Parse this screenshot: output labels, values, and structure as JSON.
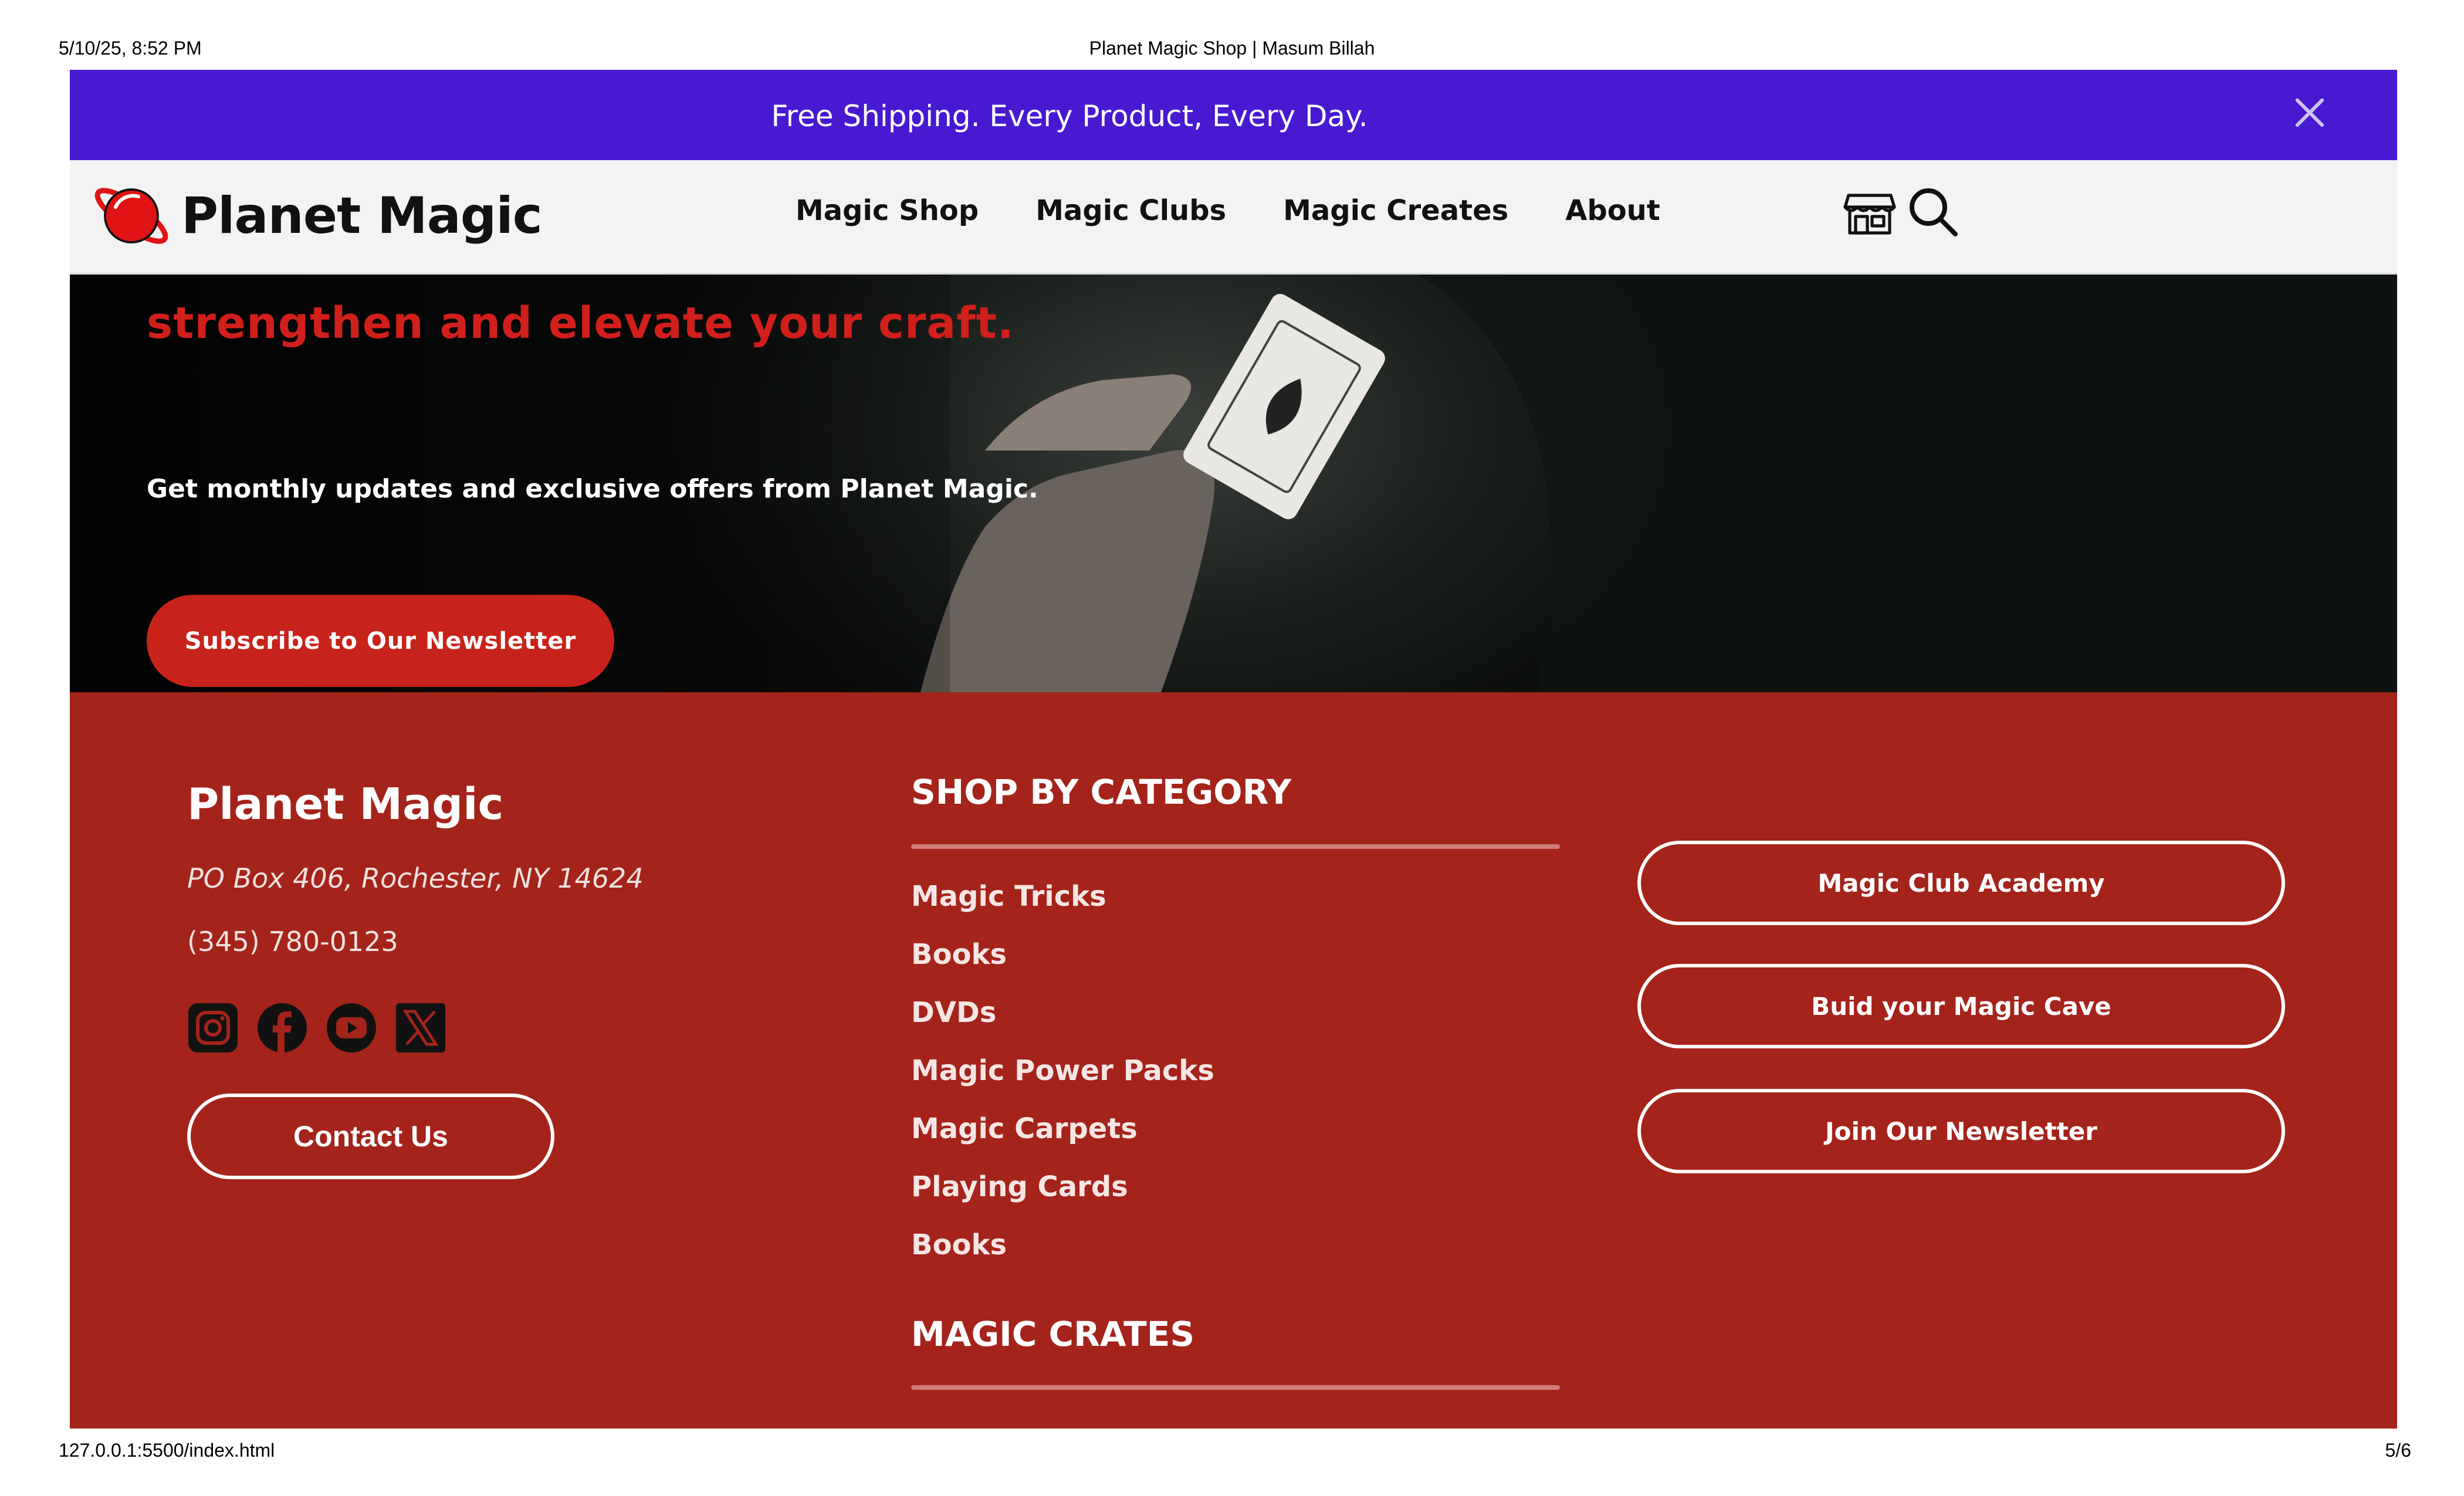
{
  "print": {
    "datetime": "5/10/25, 8:52 PM",
    "title": "Planet Magic Shop | Masum Billah",
    "url": "127.0.0.1:5500/index.html",
    "page": "5/6"
  },
  "announcement": {
    "text": "Free Shipping. Every Product, Every Day.",
    "close_icon": "close-icon",
    "background": "#4719d1"
  },
  "navbar": {
    "brand": "Planet Magic",
    "links": [
      "Magic Shop",
      "Magic Clubs",
      "Magic Creates",
      "About"
    ],
    "icons": [
      "store-icon",
      "search-icon"
    ]
  },
  "hero": {
    "heading": "strengthen and elevate your craft.",
    "subtext": "Get monthly updates and exclusive offers from Planet Magic.",
    "button": "Subscribe to Our Newsletter",
    "accent": "#d11f1c"
  },
  "footer": {
    "brand": "Planet Magic",
    "address": "PO Box 406, Rochester, NY 14624",
    "phone": "(345) 780-0123",
    "socials": [
      "instagram-icon",
      "facebook-icon",
      "youtube-icon",
      "x-icon"
    ],
    "contact_button": "Contact Us",
    "shop_heading": "SHOP BY CATEGORY",
    "categories": [
      "Magic Tricks",
      "Books",
      "DVDs",
      "Magic Power Packs",
      "Magic Carpets",
      "Playing Cards",
      "Books"
    ],
    "crates_heading": "MAGIC CRATES",
    "buttons": [
      "Magic Club Academy",
      "Buid your Magic Cave",
      "Join Our Newsletter"
    ],
    "background": "#a4231b"
  }
}
